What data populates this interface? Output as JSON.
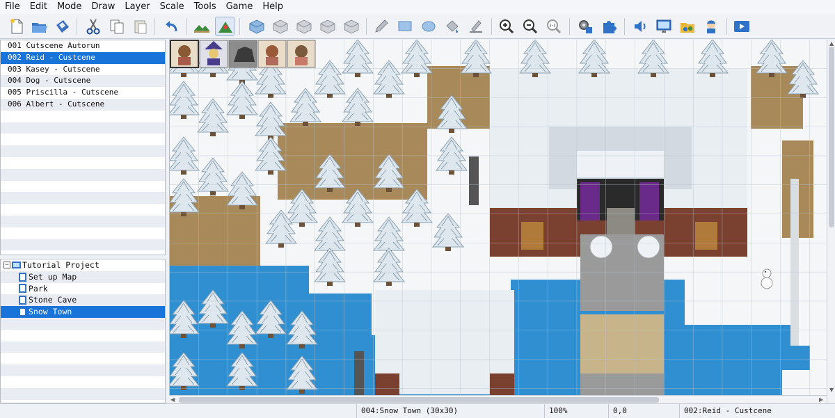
{
  "menu": [
    "File",
    "Edit",
    "Mode",
    "Draw",
    "Layer",
    "Scale",
    "Tools",
    "Game",
    "Help"
  ],
  "toolbar": {
    "icons": [
      "new-project-icon",
      "open-project-icon",
      "save-project-icon",
      "cut-icon",
      "copy-icon",
      "paste-icon",
      "undo-icon",
      "map-mode-icon",
      "event-mode-icon",
      "layer-1-icon",
      "layer-2-icon",
      "layer-3-icon",
      "layer-4-icon",
      "layer-5-icon",
      "pencil-icon",
      "rectangle-icon",
      "ellipse-icon",
      "flood-fill-icon",
      "shadow-pen-icon",
      "zoom-in-icon",
      "zoom-out-icon",
      "actual-size-icon",
      "database-icon",
      "plugin-manager-icon",
      "sound-test-icon",
      "event-searcher-icon",
      "resource-manager-icon",
      "character-generator-icon",
      "playtest-icon"
    ]
  },
  "events": {
    "items": [
      {
        "label": "001 Cutscene Autorun",
        "selected": false
      },
      {
        "label": "002 Reid - Custcene",
        "selected": true
      },
      {
        "label": "003 Kasey - Cutscene",
        "selected": false
      },
      {
        "label": "004 Dog - Cutscene",
        "selected": false
      },
      {
        "label": "005 Priscilla - Cutscene",
        "selected": false
      },
      {
        "label": "006 Albert - Cutscene",
        "selected": false
      }
    ]
  },
  "map_tree": {
    "project": "Tutorial Project",
    "maps": [
      {
        "label": "Set up Map",
        "selected": false
      },
      {
        "label": "Park",
        "selected": false
      },
      {
        "label": "Stone Cave",
        "selected": false
      },
      {
        "label": "Snow Town",
        "selected": true
      }
    ]
  },
  "status": {
    "map": "004:Snow Town (30x30)",
    "zoom": "100%",
    "coords": "0,0",
    "event": "002:Reid - Custcene"
  },
  "colors": {
    "selection": "#1874d8",
    "water": "#2f8fd0",
    "snow": "#f4f6f8",
    "dirt": "#a8895a"
  }
}
